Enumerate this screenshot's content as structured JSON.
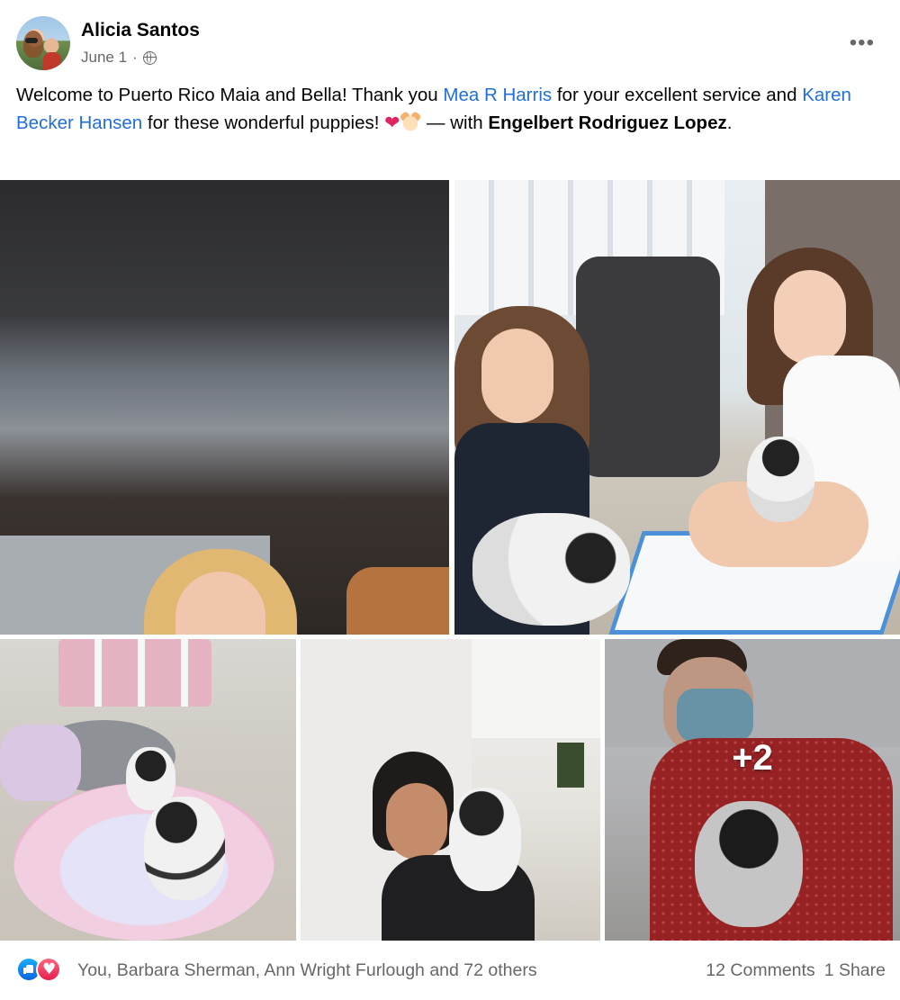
{
  "post": {
    "author": "Alicia Santos",
    "date": "June 1",
    "date_separator": "·",
    "more_glyph": "•••",
    "text": {
      "part1": "Welcome to Puerto Rico Maia and Bella! Thank you ",
      "mention1": "Mea R Harris",
      "part2": " for your excellent service and ",
      "mention2": "Karen Becker Hansen",
      "part3": " for these wonderful puppies! ",
      "heart": "❤",
      "part4": " — with ",
      "tagged": "Engelbert Rodriguez Lopez",
      "part5": "."
    },
    "photos": {
      "extra_count_label": "+2"
    },
    "reactions": {
      "icons": [
        "like-icon",
        "love-icon"
      ],
      "names_text": "You, Barbara Sherman, Ann Wright Furlough and 72 others",
      "comments": "12 Comments",
      "shares": "1 Share"
    }
  },
  "colors": {
    "link": "#216fdb",
    "meta": "#65676b",
    "like": "#1877f2",
    "love": "#e61e4d"
  }
}
